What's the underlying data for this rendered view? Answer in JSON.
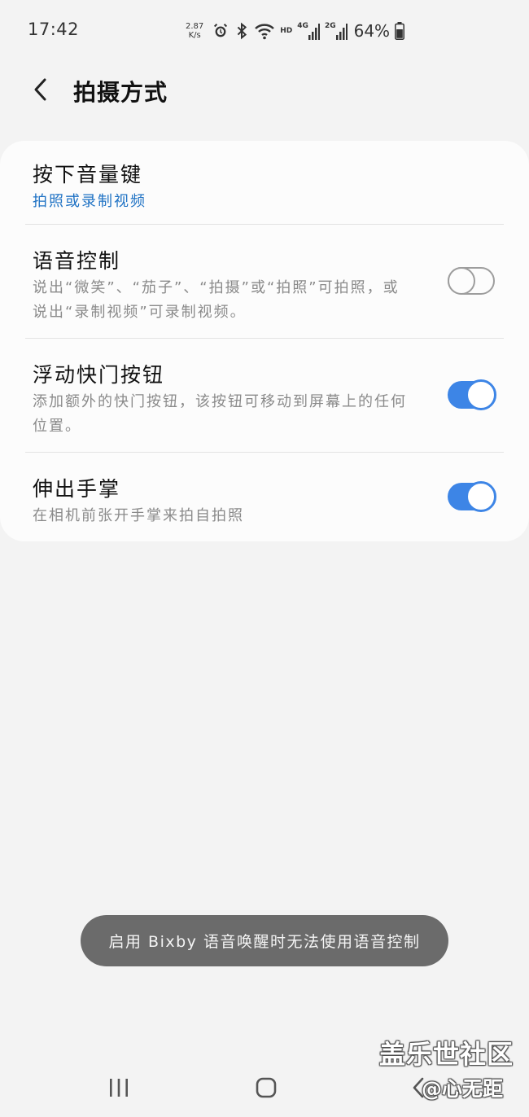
{
  "status_bar": {
    "time": "17:42",
    "net_speed_value": "2.87",
    "net_speed_unit": "K/s",
    "hd_label": "HD",
    "lte_label": "4G",
    "g2_label": "2G",
    "battery": "64%"
  },
  "header": {
    "title": "拍摄方式"
  },
  "settings": {
    "volume_key": {
      "title": "按下音量键",
      "subtitle": "拍照或录制视频"
    },
    "voice_control": {
      "title": "语音控制",
      "subtitle": "说出“微笑”、“茄子”、“拍摄”或“拍照”可拍照，或说出“录制视频”可录制视频。",
      "enabled": false
    },
    "floating_shutter": {
      "title": "浮动快门按钮",
      "subtitle": "添加额外的快门按钮，该按钮可移动到屏幕上的任何位置。",
      "enabled": true
    },
    "palm": {
      "title": "伸出手掌",
      "subtitle": "在相机前张开手掌来拍自拍照",
      "enabled": true
    }
  },
  "toast": {
    "text": "启用 Bixby 语音唤醒时无法使用语音控制"
  },
  "watermark": {
    "line1": "盖乐世社区",
    "line2": "@心无距"
  },
  "colors": {
    "accent": "#3d85e6",
    "link": "#1f72c4",
    "background": "#f3f3f3",
    "card": "#fcfcfc"
  }
}
